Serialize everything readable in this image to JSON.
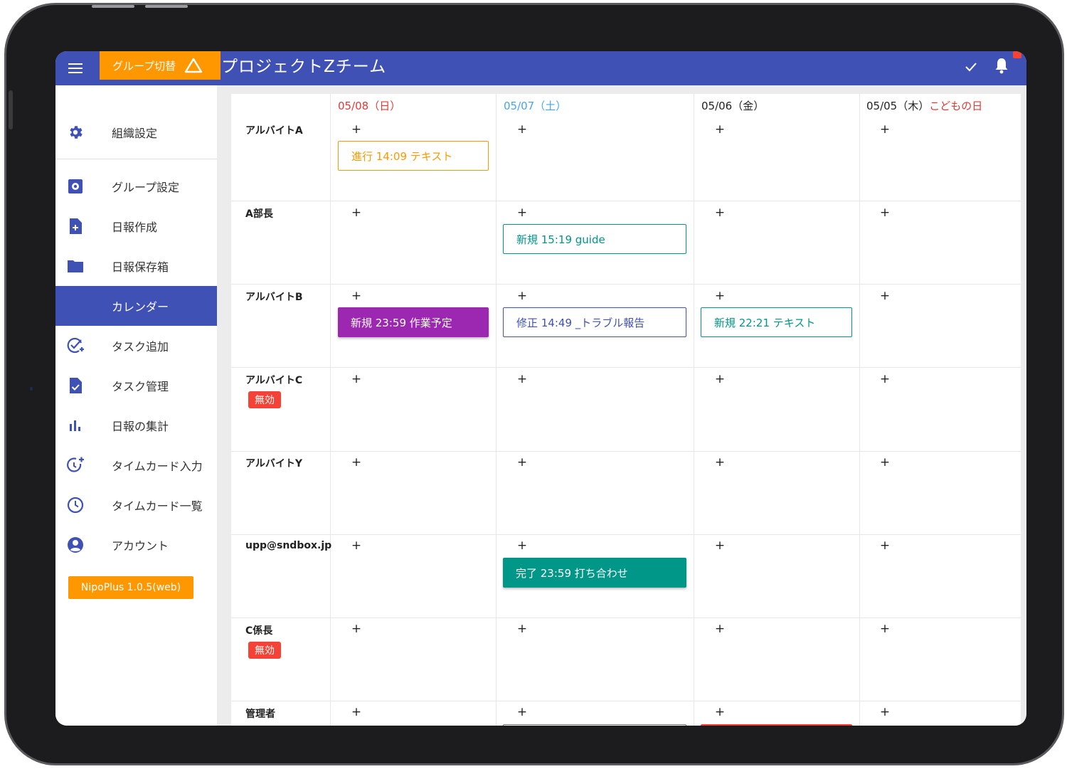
{
  "appbar": {
    "group_switch_label": "グループ切替",
    "title": "プロジェクトZチーム"
  },
  "sidebar": {
    "items": [
      {
        "label": "組織設定",
        "icon": "gear-icon"
      },
      {
        "label": "グループ設定",
        "icon": "settings-box-icon"
      },
      {
        "label": "日報作成",
        "icon": "file-plus-icon"
      },
      {
        "label": "日報保存箱",
        "icon": "folder-icon"
      },
      {
        "label": "カレンダー",
        "icon": "calendar-icon",
        "active": true
      },
      {
        "label": "タスク追加",
        "icon": "check-add-icon"
      },
      {
        "label": "タスク管理",
        "icon": "file-check-icon"
      },
      {
        "label": "日報の集計",
        "icon": "bar-chart-icon"
      },
      {
        "label": "タイムカード入力",
        "icon": "clock-add-icon"
      },
      {
        "label": "タイムカード一覧",
        "icon": "clock-icon"
      },
      {
        "label": "アカウント",
        "icon": "account-icon"
      }
    ],
    "version": "NipoPlus 1.0.5(web)"
  },
  "calendar": {
    "days": [
      {
        "date": "05/08（日）",
        "color": "#e53935"
      },
      {
        "date": "05/07（土）",
        "color": "#42a5f5"
      },
      {
        "date": "05/06（金）",
        "color": "#222222"
      },
      {
        "date": "05/05（木）",
        "holiday": "こどもの日",
        "color": "#222222",
        "holiday_color": "#e53935"
      }
    ],
    "rows": [
      {
        "name": "アルバイトA",
        "invalid": ""
      },
      {
        "name": "A部長",
        "invalid": ""
      },
      {
        "name": "アルバイトB",
        "invalid": ""
      },
      {
        "name": "アルバイトC",
        "invalid": "無効"
      },
      {
        "name": "アルバイトY",
        "invalid": ""
      },
      {
        "name": "upp@sndbox.jp",
        "invalid": ""
      },
      {
        "name": "C係長",
        "invalid": "無効"
      },
      {
        "name": "管理者",
        "invalid": ""
      }
    ],
    "add_symbol": "+",
    "events": {
      "a_sun": "進行 14:09 テキスト",
      "bucho_sat": "新規 15:19 guide",
      "b_sun": "新規 23:59 作業予定",
      "b_sat": "修正 14:49 _トラブル報告",
      "b_fri": "新規 22:21 テキスト",
      "upp_sat": "完了 23:59 打ち合わせ"
    }
  },
  "colors": {
    "primary": "#3f51b5",
    "accent": "#ff9800",
    "danger": "#f44336",
    "teal": "#009688",
    "purple": "#9c27b0"
  }
}
